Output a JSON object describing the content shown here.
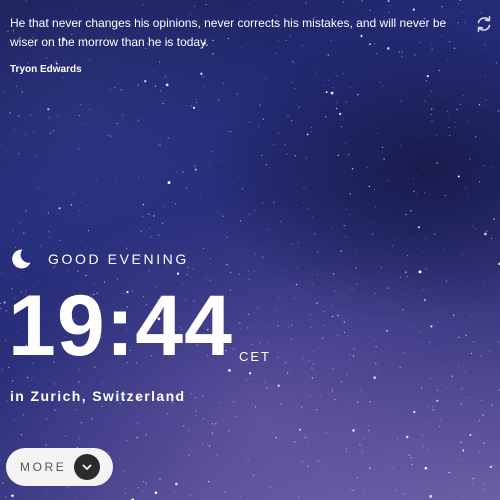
{
  "quote": {
    "text": "He that never changes his opinions, never corrects his mistakes, and will never be wiser on the morrow than he is today.",
    "author": "Tryon Edwards"
  },
  "refresh": {
    "icon": "refresh-icon"
  },
  "greeting": {
    "icon": "moon-icon",
    "text": "GOOD EVENING"
  },
  "clock": {
    "time": "19:44",
    "timezone": "CET"
  },
  "location": {
    "text": "in Zurich, Switzerland"
  },
  "more_button": {
    "label": "MORE",
    "icon": "chevron-down-icon"
  },
  "colors": {
    "text": "#ffffff",
    "button_bg": "#f4f4f4",
    "button_text": "#555555",
    "chevron_bg": "#2b2b2b"
  }
}
